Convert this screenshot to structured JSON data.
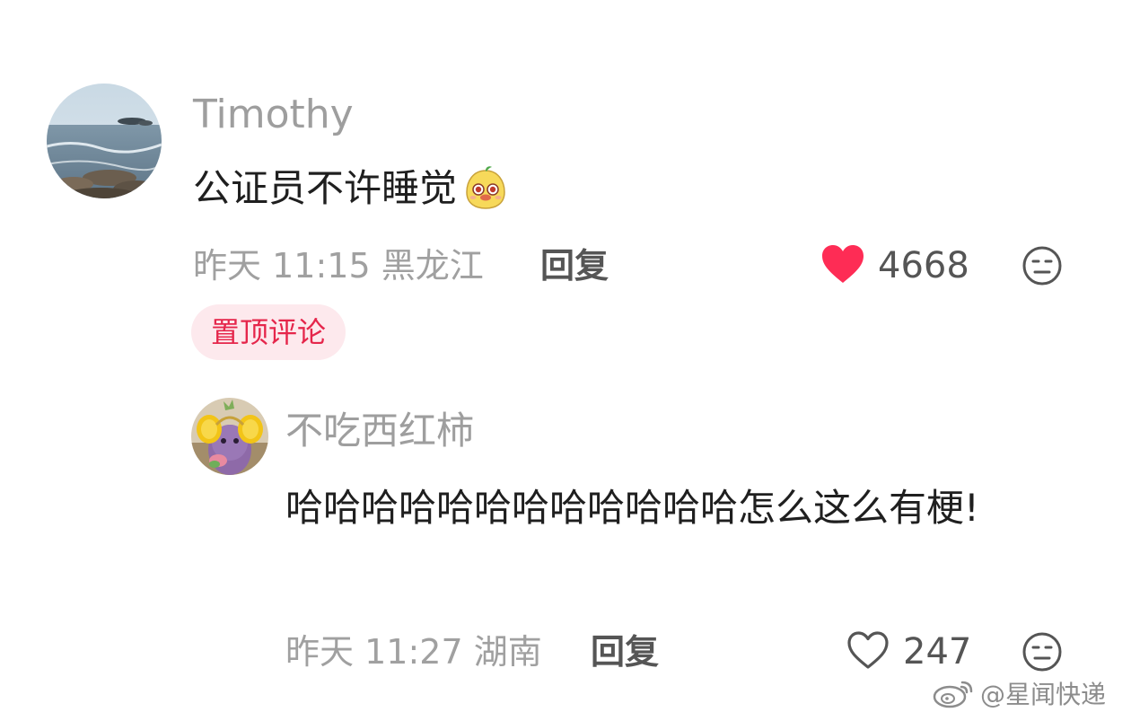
{
  "main_comment": {
    "username": "Timothy",
    "text": "公证员不许睡觉",
    "emoji": "smiling-pear-emoji",
    "date": "昨天",
    "time": "11:15",
    "location": "黑龙江",
    "reply_label": "回复",
    "like_count": "4668",
    "liked": true,
    "badge": "置顶评论"
  },
  "reply_comment": {
    "username": "不吃西红柿",
    "text": "哈哈哈哈哈哈哈哈哈哈哈哈怎么这么有梗!",
    "date": "昨天",
    "time": "11:27",
    "location": "湖南",
    "reply_label": "回复",
    "like_count": "247",
    "liked": false
  },
  "watermark": {
    "text": "@星闻快递",
    "icon": "weibo-icon"
  },
  "colors": {
    "like_red": "#fe2c55",
    "badge_bg": "#fde9ed",
    "badge_text": "#e5264b",
    "meta_gray": "#a0a0a0"
  }
}
